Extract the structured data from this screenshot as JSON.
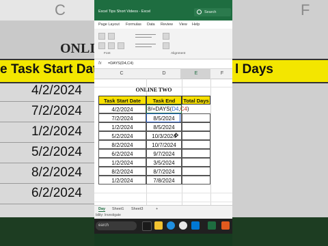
{
  "background": {
    "col_letters": [
      "C",
      "F"
    ],
    "banner_text": "ONLIN",
    "header_left": "e",
    "header_mid": "Task Start Dat",
    "header_right": "l Days",
    "dates": [
      "4/2/2024",
      "7/2/2024",
      "1/2/2024",
      "5/2/2024",
      "8/2/2024",
      "6/2/2024"
    ]
  },
  "window": {
    "title": "Excel Tips Short Videos  -  Excel",
    "search_placeholder": "Search",
    "menu": [
      "Page Layout",
      "Formulas",
      "Data",
      "Review",
      "View",
      "Help"
    ],
    "ribbon_groups": [
      "Font",
      "Alignment"
    ]
  },
  "formula_bar": {
    "fx": "fx",
    "formula": "=DAYS(D4,C4)"
  },
  "columns": [
    "C",
    "D",
    "E",
    "F"
  ],
  "table": {
    "title": "ONLINE TWO",
    "headers": [
      "Task Start Date",
      "Task End Date",
      "Total Days"
    ],
    "rows": [
      {
        "start": "4/2/2024",
        "end": "",
        "total": ""
      },
      {
        "start": "7/2/2024",
        "end": "8/5/2024",
        "total": ""
      },
      {
        "start": "1/2/2024",
        "end": "8/5/2024",
        "total": ""
      },
      {
        "start": "5/2/2024",
        "end": "10/3/2024",
        "total": ""
      },
      {
        "start": "8/2/2024",
        "end": "10/7/2024",
        "total": ""
      },
      {
        "start": "6/2/2024",
        "end": "9/7/2024",
        "total": ""
      },
      {
        "start": "1/2/2024",
        "end": "3/5/2024",
        "total": ""
      },
      {
        "start": "8/2/2024",
        "end": "8/7/2024",
        "total": ""
      },
      {
        "start": "1/2/2024",
        "end": "7/8/2024",
        "total": ""
      }
    ],
    "editing": {
      "prefix": "8",
      "cursor": "/",
      "fn": "=DAYS(",
      "arg1": "D4",
      "comma": ",",
      "arg2": "C4",
      "close": ")"
    }
  },
  "sheet_tabs": [
    "Day",
    "Sheet1",
    "Sheet3",
    "+"
  ],
  "status_text": "bility: Investigate",
  "taskbar": {
    "search_label": "earch"
  },
  "colors": {
    "excel_green": "#1e6d40",
    "header_yellow": "#f7e000"
  }
}
